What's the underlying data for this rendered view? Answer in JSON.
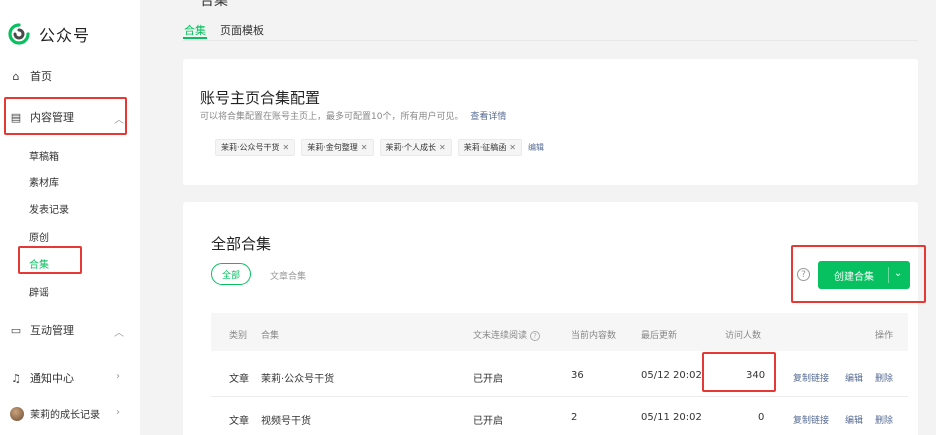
{
  "brand": {
    "name": "公众号",
    "color": "#07c160"
  },
  "header": {
    "title_fragment": "合集"
  },
  "tabs": [
    {
      "label": "合集",
      "active": true
    },
    {
      "label": "页面模板",
      "active": false
    }
  ],
  "sidebar": {
    "home": "首页",
    "content_mgmt": "内容管理",
    "content_items": [
      "草稿箱",
      "素材库",
      "发表记录",
      "原创",
      "合集",
      "辟谣"
    ],
    "interaction_mgmt": "互动管理",
    "notifications": "通知中心",
    "account": "茉莉的成长记录"
  },
  "homepage_config": {
    "title": "账号主页合集配置",
    "desc": "可以将合集配置在账号主页上，最多可配置10个，所有用户可见。",
    "desc_link": "查看详情",
    "tags": [
      "茉莉·公众号干货",
      "茉莉·金句整理",
      "茉莉·个人成长",
      "茉莉·征稿函"
    ],
    "edit": "编辑"
  },
  "all_collections": {
    "title": "全部合集",
    "filters": [
      "全部",
      "文章合集"
    ],
    "create_button": "创建合集",
    "help": "?",
    "columns": [
      "类别",
      "合集",
      "文末连续阅读",
      "当前内容数",
      "最后更新",
      "访问人数",
      "操作"
    ],
    "rows": [
      {
        "type": "文章",
        "name": "茉莉·公众号干货",
        "continuous": "已开启",
        "count": "36",
        "updated": "05/12 20:02",
        "visitors": "340"
      },
      {
        "type": "文章",
        "name": "视频号干货",
        "continuous": "已开启",
        "count": "2",
        "updated": "05/11 20:02",
        "visitors": "0"
      }
    ],
    "ops": {
      "copy": "复制链接",
      "edit": "编辑",
      "delete": "删除"
    }
  },
  "highlight_color": "#e53935"
}
